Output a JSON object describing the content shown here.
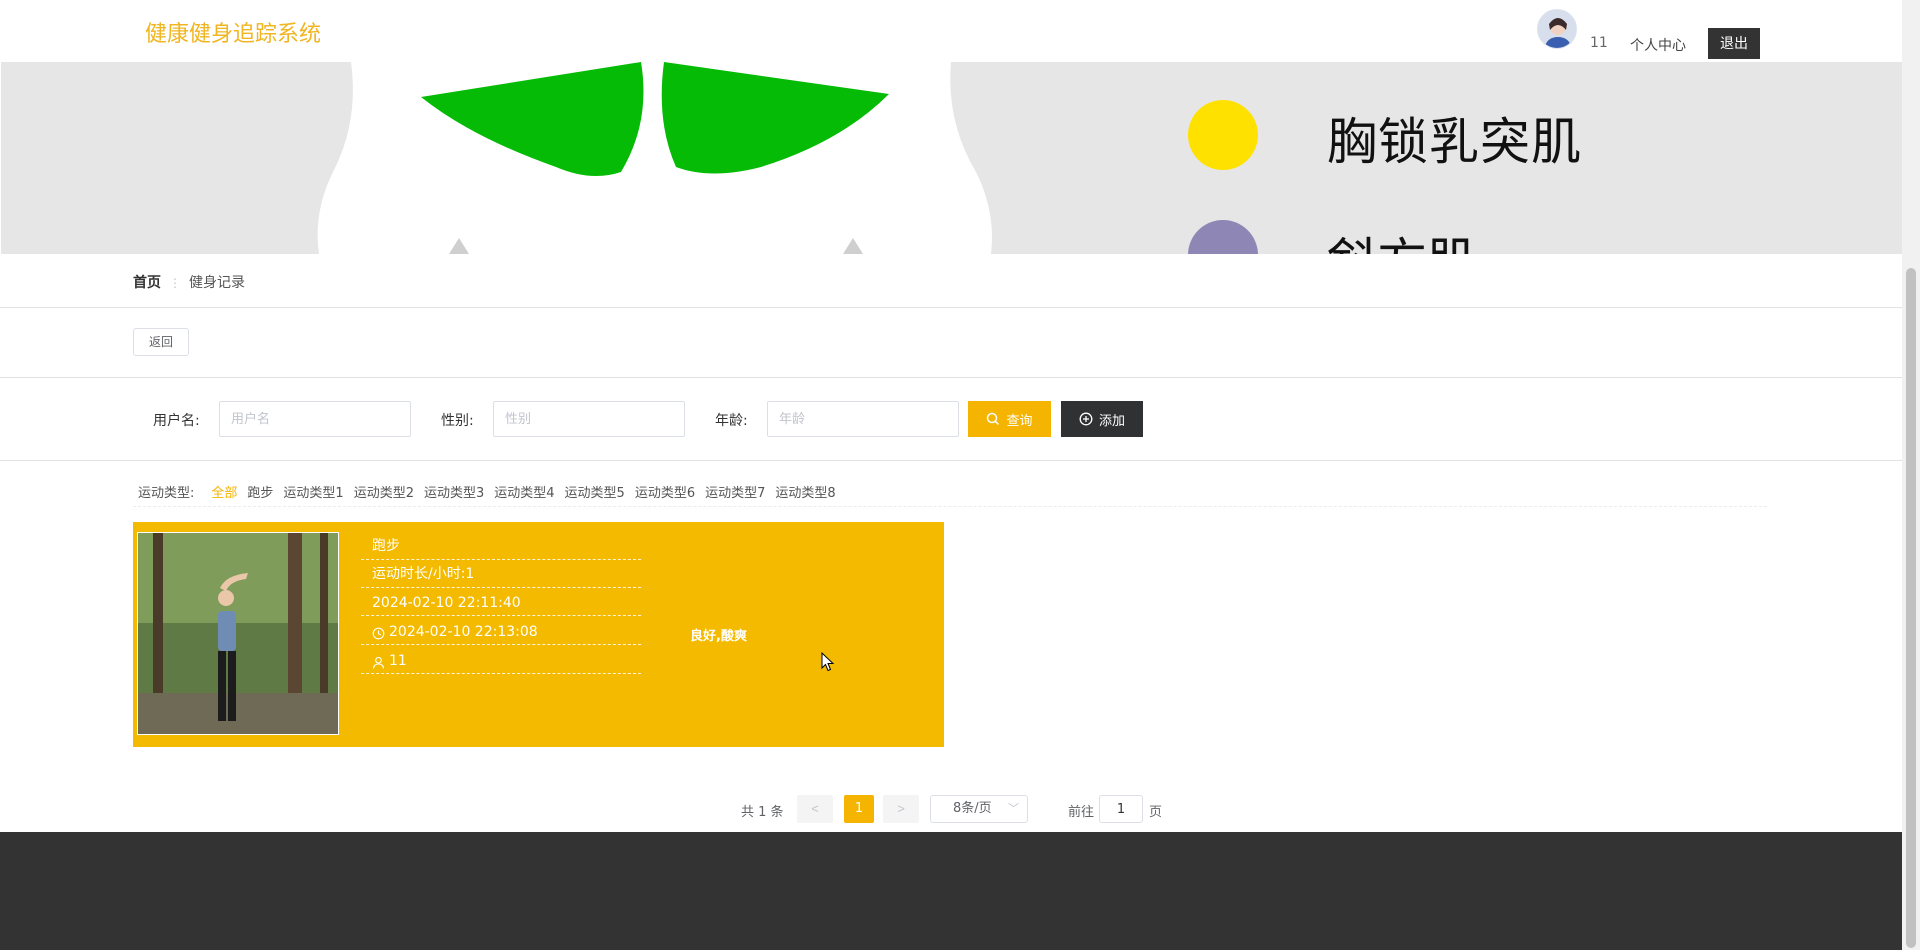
{
  "header": {
    "brand": "健康健身追踪系统",
    "user_count": "11",
    "personal_center": "个人中心",
    "logout": "退出"
  },
  "banner": {
    "legend": [
      {
        "label": "胸锁乳突肌",
        "color": "#ffe100"
      },
      {
        "label": "斜方肌",
        "color": "#8e87b5"
      }
    ],
    "muscle_color": "#06bb06"
  },
  "breadcrumb": {
    "home": "首页",
    "separator": "⋮",
    "current": "健身记录"
  },
  "back_button": "返回",
  "search": {
    "username_label": "用户名:",
    "username_placeholder": "用户名",
    "gender_label": "性别:",
    "gender_placeholder": "性别",
    "age_label": "年龄:",
    "age_placeholder": "年龄",
    "query_button": "查询",
    "add_button": "添加"
  },
  "categories": {
    "label": "运动类型:",
    "items": [
      "全部",
      "跑步",
      "运动类型1",
      "运动类型2",
      "运动类型3",
      "运动类型4",
      "运动类型5",
      "运动类型6",
      "运动类型7",
      "运动类型8"
    ],
    "active": "全部"
  },
  "card": {
    "type": "跑步",
    "duration": "运动时长/小时:1",
    "start_time": "2024-02-10 22:11:40",
    "record_time": "2024-02-10 22:13:08",
    "user": "11",
    "feeling": "良好,酸爽"
  },
  "pagination": {
    "total": "共 1 条",
    "prev": "<",
    "current_page": "1",
    "next": ">",
    "page_size": "8条/页",
    "goto_label": "前往",
    "goto_value": "1",
    "page_unit": "页"
  },
  "colors": {
    "accent": "#f4b400",
    "dark": "#333333"
  }
}
